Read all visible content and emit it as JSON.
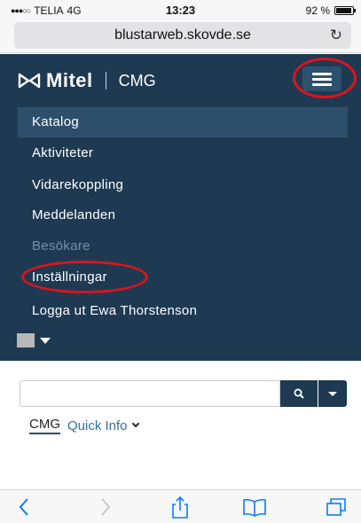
{
  "status_bar": {
    "carrier": "TELIA",
    "network": "4G",
    "time": "13:23",
    "battery_text": "92 %",
    "battery_level": 0.92
  },
  "browser": {
    "url": "blustarweb.skovde.se",
    "reload_icon": "reload-icon"
  },
  "header": {
    "logo_text": "Mitel",
    "app_name": "CMG",
    "menu_icon": "hamburger-icon"
  },
  "nav": {
    "items": [
      {
        "label": "Katalog",
        "state": "active"
      },
      {
        "label": "Aktiviteter",
        "state": "normal"
      },
      {
        "label": "Vidarekoppling",
        "state": "normal"
      },
      {
        "label": "Meddelanden",
        "state": "normal"
      },
      {
        "label": "Besökare",
        "state": "disabled"
      },
      {
        "label": "Inställningar",
        "state": "normal"
      },
      {
        "label": "Logga ut Ewa Thorstenson",
        "state": "normal"
      }
    ]
  },
  "search": {
    "value": "",
    "placeholder": ""
  },
  "tabs": {
    "cmg": "CMG",
    "quick_info": "Quick Info"
  },
  "toolbar": {
    "icons": [
      "back-icon",
      "forward-icon",
      "share-icon",
      "bookmarks-icon",
      "tabs-icon"
    ]
  },
  "colors": {
    "header_bg": "#1d3a52",
    "active_item_bg": "#2e4f6c",
    "annotation_red": "#e0121b",
    "link_blue": "#2f6fa8",
    "ios_blue": "#0a7aff"
  }
}
